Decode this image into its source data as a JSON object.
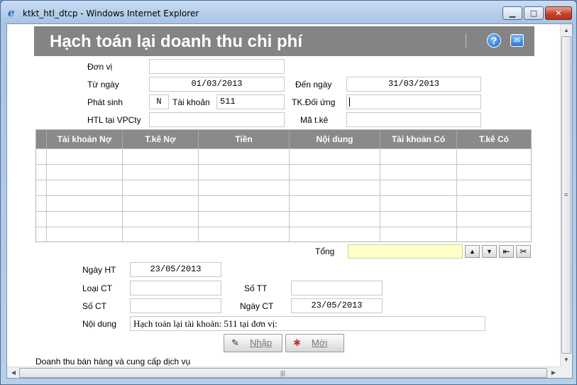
{
  "window": {
    "title": "ktkt_htl_dtcp - Windows Internet Explorer",
    "min_glyph": "▁",
    "max_glyph": "□",
    "close_glyph": "✕"
  },
  "header": {
    "title": "Hạch toán lại doanh thu chi phí",
    "help_glyph": "?",
    "mail_glyph": "✉"
  },
  "form": {
    "don_vi_label": "Đơn vị",
    "don_vi_value": "",
    "tu_ngay_label": "Từ ngày",
    "tu_ngay_value": "01/03/2013",
    "den_ngay_label": "Đến ngày",
    "den_ngay_value": "31/03/2013",
    "phat_sinh_label": "Phát sinh",
    "phat_sinh_value": "N",
    "tai_khoan_label": "Tài khoản",
    "tai_khoan_value": "511",
    "tk_doi_ung_label": "TK.Đối ứng",
    "tk_doi_ung_value": "",
    "htl_vpcty_label": "HTL tại VPCty",
    "htl_vpcty_value": "",
    "ma_tke_label": "Mã t.kê",
    "ma_tke_value": ""
  },
  "grid": {
    "columns": [
      "Tài khoản Nợ",
      "T.kê Nợ",
      "Tiền",
      "Nội dung",
      "Tài khoản Có",
      "T.kê Có"
    ],
    "rows": [
      [
        "",
        "",
        "",
        "",
        "",
        ""
      ],
      [
        "",
        "",
        "",
        "",
        "",
        ""
      ],
      [
        "",
        "",
        "",
        "",
        "",
        ""
      ],
      [
        "",
        "",
        "",
        "",
        "",
        ""
      ],
      [
        "",
        "",
        "",
        "",
        "",
        ""
      ],
      [
        "",
        "",
        "",
        "",
        "",
        ""
      ]
    ]
  },
  "totals": {
    "tong_label": "Tổng",
    "tong_value": "",
    "up_glyph": "▲",
    "down_glyph": "▼",
    "insert_glyph": "⇤",
    "cut_glyph": "✂"
  },
  "detail": {
    "ngay_ht_label": "Ngày HT",
    "ngay_ht_value": "23/05/2013",
    "loai_ct_label": "Loại CT",
    "loai_ct_value": "",
    "so_tt_label": "Số TT",
    "so_tt_value": "",
    "so_ct_label": "Số CT",
    "so_ct_value": "",
    "ngay_ct_label": "Ngày CT",
    "ngay_ct_value": "23/05/2013",
    "noi_dung_label": "Nội dung",
    "noi_dung_value": "Hạch toán lại tài khoản: 511 tại đơn vị:"
  },
  "actions": {
    "nhap_label": "Nhập",
    "moi_label": "Mới"
  },
  "status": {
    "text": "Doanh thu bán hàng và cung cấp dịch vụ"
  },
  "scrollbars": {
    "up": "▲",
    "down": "▼",
    "left": "◀",
    "right": "▶",
    "vgrip": "≡",
    "hgrip": "|||"
  }
}
